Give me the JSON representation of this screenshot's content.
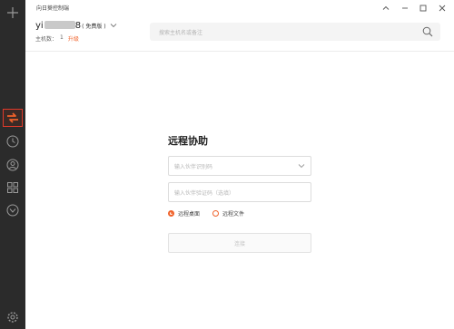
{
  "window": {
    "title": "向日葵控制端"
  },
  "sidebar": {
    "items": [
      {
        "name": "add",
        "icon": "plus-icon"
      },
      {
        "name": "remote-assist",
        "icon": "remote-swap-icon",
        "active": true
      },
      {
        "name": "history",
        "icon": "clock-icon"
      },
      {
        "name": "contacts",
        "icon": "contact-icon"
      },
      {
        "name": "apps",
        "icon": "apps-grid-icon"
      },
      {
        "name": "devices",
        "icon": "cube-icon"
      },
      {
        "name": "settings",
        "icon": "gear-icon"
      }
    ]
  },
  "header": {
    "user_prefix": "yi",
    "user_suffix": "8",
    "user_plan": "( 免费版 )",
    "hosts_label": "主机数：",
    "hosts_count": "1",
    "upgrade_label": "升级",
    "search_placeholder": "搜索主机名或备注"
  },
  "remote_assist": {
    "title": "远程协助",
    "partner_id_placeholder": "输入伙伴识别码",
    "partner_code_placeholder": "输入伙伴验证码（选填）",
    "mode_options": [
      "远程桌面",
      "远程文件"
    ],
    "selected_mode": "远程桌面",
    "connect_label": "连接"
  },
  "colors": {
    "accent": "#f0622a",
    "sidebar_bg": "#2b2b2b",
    "active_outline": "#e03a2a"
  }
}
